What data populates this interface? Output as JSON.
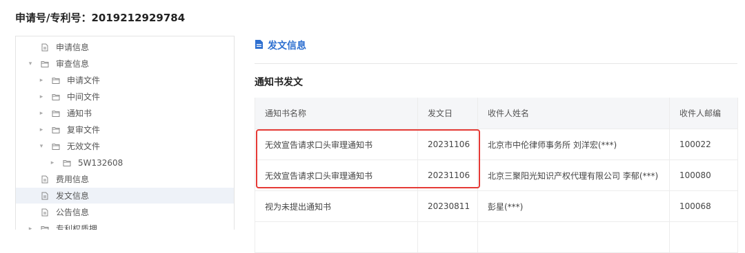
{
  "header": {
    "title": "申请号/专利号：2019212929784"
  },
  "tree": {
    "items": [
      {
        "label": "申请信息",
        "type": "file",
        "level": 0,
        "expanded": null,
        "active": false
      },
      {
        "label": "审查信息",
        "type": "folder",
        "level": 0,
        "expanded": true,
        "active": false
      },
      {
        "label": "申请文件",
        "type": "folder",
        "level": 1,
        "expanded": false,
        "active": false
      },
      {
        "label": "中间文件",
        "type": "folder",
        "level": 1,
        "expanded": false,
        "active": false
      },
      {
        "label": "通知书",
        "type": "folder",
        "level": 1,
        "expanded": false,
        "active": false
      },
      {
        "label": "复审文件",
        "type": "folder",
        "level": 1,
        "expanded": false,
        "active": false
      },
      {
        "label": "无效文件",
        "type": "folder",
        "level": 1,
        "expanded": true,
        "active": false
      },
      {
        "label": "5W132608",
        "type": "folder",
        "level": 2,
        "expanded": false,
        "active": false
      },
      {
        "label": "费用信息",
        "type": "file",
        "level": 0,
        "expanded": null,
        "active": false
      },
      {
        "label": "发文信息",
        "type": "file",
        "level": 0,
        "expanded": null,
        "active": true
      },
      {
        "label": "公告信息",
        "type": "file",
        "level": 0,
        "expanded": null,
        "active": false
      },
      {
        "label": "专利权质押",
        "type": "folder",
        "level": 0,
        "expanded": false,
        "active": false
      }
    ]
  },
  "main": {
    "header": "发文信息",
    "section_title": "通知书发文",
    "table": {
      "columns": [
        "通知书名称",
        "发文日",
        "收件人姓名",
        "收件人邮编"
      ],
      "rows": [
        [
          "无效宣告请求口头审理通知书",
          "20231106",
          "北京市中伦律师事务所 刘洋宏(***)",
          "100022"
        ],
        [
          "无效宣告请求口头审理通知书",
          "20231106",
          "北京三聚阳光知识产权代理有限公司 李郁(***)",
          "100080"
        ],
        [
          "视为未提出通知书",
          "20230811",
          "彭星(***)",
          "100068"
        ],
        [
          "",
          "",
          "",
          ""
        ]
      ]
    }
  },
  "colors": {
    "accent": "#2d6fd0",
    "highlight": "#e53935",
    "active_row": "#eef2f8"
  }
}
